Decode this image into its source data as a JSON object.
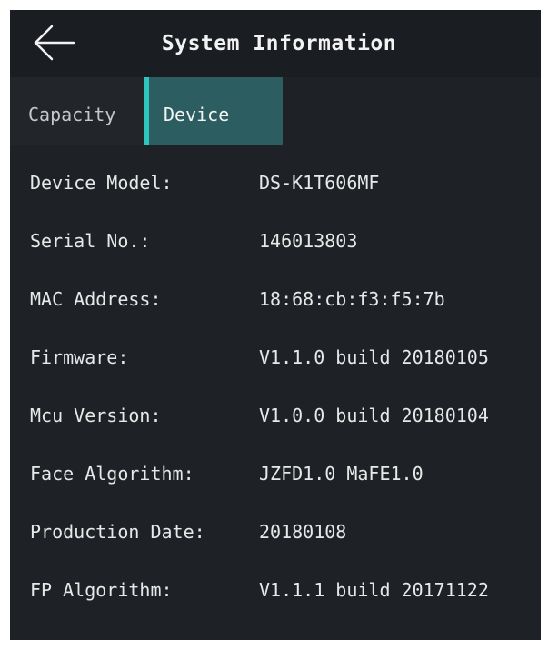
{
  "header": {
    "title": "System Information",
    "back_icon": "arrow-left-icon"
  },
  "tabs": [
    {
      "label": "Capacity",
      "selected": false
    },
    {
      "label": "Device",
      "selected": true
    }
  ],
  "colors": {
    "background": "#1e2126",
    "title_bar": "#1a1d22",
    "tab_selected_bg": "#2c5d60",
    "tab_indicator": "#2fc4bf",
    "text": "#e8e8e8"
  },
  "device_info": [
    {
      "label": "Device Model:",
      "value": "DS-K1T606MF"
    },
    {
      "label": "Serial No.:",
      "value": "146013803"
    },
    {
      "label": "MAC Address:",
      "value": "18:68:cb:f3:f5:7b"
    },
    {
      "label": "Firmware:",
      "value": "V1.1.0 build 20180105"
    },
    {
      "label": "Mcu Version:",
      "value": "V1.0.0 build 20180104"
    },
    {
      "label": "Face Algorithm:",
      "value": "JZFD1.0 MaFE1.0"
    },
    {
      "label": "Production Date:",
      "value": "20180108"
    },
    {
      "label": "FP Algorithm:",
      "value": "V1.1.1 build 20171122"
    }
  ]
}
